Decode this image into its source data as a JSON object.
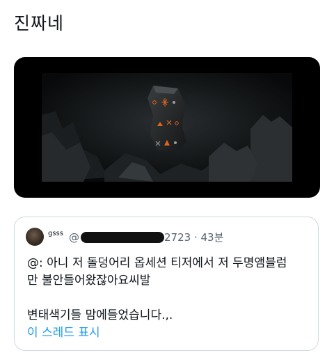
{
  "tweet": {
    "text": "진짜네"
  },
  "media": {
    "icon": "video-thumbnail"
  },
  "quote": {
    "author": {
      "name": "gsss",
      "handle_prefix": "@",
      "handle_suffix": "2723",
      "separator": "·",
      "time": "43분"
    },
    "body": {
      "line1": "@: 아니 저 돌덩어리 옵세션 티저에서 저 두명앰블럼",
      "line2": "만 불안들어왔잖아요씨발",
      "line3": "변태색기들 맘에들었습니다.,."
    },
    "show_thread": "이 스레드 표시"
  },
  "colors": {
    "link": "#1d9bf0",
    "text": "#0f1419",
    "muted": "#536471",
    "border": "#cfd9de"
  }
}
